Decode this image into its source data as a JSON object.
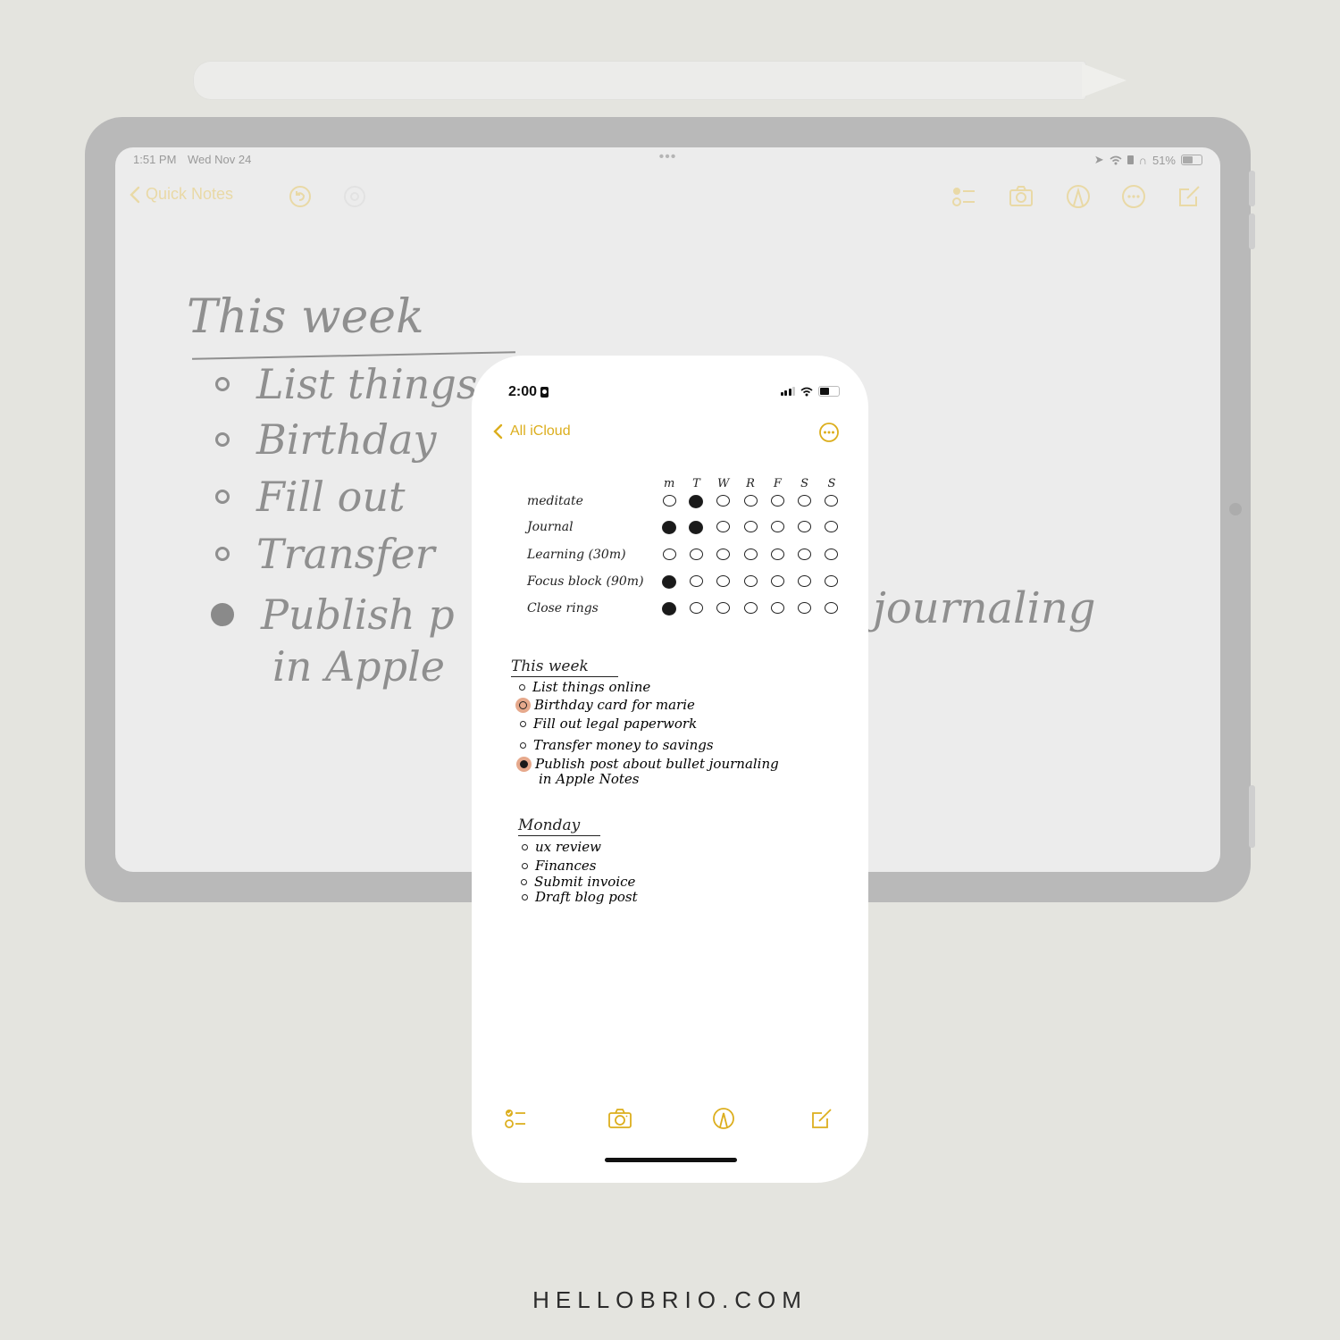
{
  "pencil": {
    "name": "apple-pencil"
  },
  "ipad": {
    "status_bar": {
      "time": "1:51 PM",
      "date": "Wed Nov 24",
      "battery": "51%",
      "battery_level": 0.51,
      "icons": [
        "location-icon",
        "wifi-icon",
        "lock-rotation-icon",
        "headphones-icon",
        "battery-icon"
      ]
    },
    "multitasking_dots": "•••",
    "toolbar": {
      "back_label": "Quick Notes",
      "icons": [
        "undo-icon",
        "redo-icon",
        "checklist-icon",
        "camera-icon",
        "markup-icon",
        "more-icon",
        "compose-icon"
      ]
    },
    "note": {
      "title": "This week",
      "items": [
        {
          "text": "List things",
          "bullet": "open"
        },
        {
          "text": "Birthday",
          "bullet": "open"
        },
        {
          "text": "Fill out",
          "bullet": "open"
        },
        {
          "text": "Transfer",
          "bullet": "open"
        },
        {
          "text": "Publish p",
          "bullet": "filled"
        },
        {
          "text": "in Apple",
          "bullet": "none"
        }
      ],
      "overflow_text": "journaling"
    }
  },
  "iphone": {
    "status_bar": {
      "time": "2:00",
      "battery_level": 0.45,
      "icons": [
        "signal-icon",
        "wifi-icon",
        "battery-icon"
      ]
    },
    "nav": {
      "back_label": "All iCloud",
      "icons": [
        "chevron-left-icon",
        "more-icon"
      ]
    },
    "habit_tracker": {
      "days": [
        "m",
        "T",
        "W",
        "R",
        "F",
        "S",
        "S"
      ],
      "habits": [
        {
          "name": "meditate",
          "done": [
            false,
            true,
            false,
            false,
            false,
            false,
            false
          ]
        },
        {
          "name": "Journal",
          "done": [
            true,
            true,
            false,
            false,
            false,
            false,
            false
          ]
        },
        {
          "name": "Learning (30m)",
          "done": [
            false,
            false,
            false,
            false,
            false,
            false,
            false
          ]
        },
        {
          "name": "Focus block (90m)",
          "done": [
            true,
            false,
            false,
            false,
            false,
            false,
            false
          ]
        },
        {
          "name": "Close rings",
          "done": [
            true,
            false,
            false,
            false,
            false,
            false,
            false
          ]
        }
      ]
    },
    "this_week": {
      "title": "This week",
      "tasks": [
        {
          "text": "List things online",
          "status": "open"
        },
        {
          "text": "Birthday card for marie",
          "status": "highlighted"
        },
        {
          "text": "Fill out legal paperwork",
          "status": "open"
        },
        {
          "text": "Transfer money to savings",
          "status": "open"
        },
        {
          "text": "Publish post about bullet journaling",
          "status": "highlighted-done"
        },
        {
          "text": "in Apple Notes",
          "status": "continuation"
        }
      ]
    },
    "monday": {
      "title": "Monday",
      "tasks": [
        {
          "text": "ux review"
        },
        {
          "text": "Finances"
        },
        {
          "text": "Submit invoice"
        },
        {
          "text": "Draft blog post"
        }
      ]
    },
    "toolbar": {
      "icons": [
        "checklist-icon",
        "camera-icon",
        "markup-icon",
        "compose-icon"
      ]
    }
  },
  "colors": {
    "accent": "#dcae1d",
    "accent_faded": "#e9d9a6",
    "highlight": "#e6a98c",
    "background": "#e4e4df"
  },
  "footer": {
    "text": "HELLOBRIO.COM"
  }
}
